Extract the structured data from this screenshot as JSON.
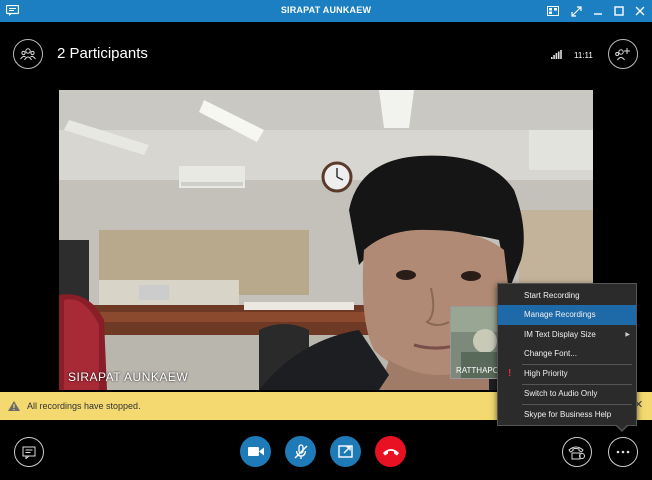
{
  "window": {
    "title": "SIRAPAT AUNKAEW",
    "controls": [
      "window-layout-icon",
      "fullscreen-icon",
      "minimize-icon",
      "maximize-icon",
      "close-icon"
    ]
  },
  "header": {
    "participants_label": "2 Participants",
    "time": "11:11"
  },
  "video": {
    "speaker_name": "SIRAPAT AUNKAEW",
    "self_view_name": "RATTHAPO"
  },
  "notification": {
    "text": "All recordings have stopped.",
    "close_label": "✕"
  },
  "menu": {
    "items": [
      {
        "label": "Start Recording"
      },
      {
        "label": "Manage Recordings"
      },
      {
        "label": "IM Text Display Size"
      },
      {
        "label": "Change Font..."
      },
      {
        "label": "High Priority"
      },
      {
        "label": "Switch to Audio Only"
      },
      {
        "label": "Skype for Business Help"
      }
    ],
    "selected_index": 1
  },
  "controls": {
    "accent": "#1f7ab8",
    "hangup_color": "#e81123",
    "buttons": [
      "im-icon",
      "video-icon",
      "mic-muted-icon",
      "present-icon",
      "hang-up-icon",
      "call-controls-icon",
      "more-options-icon"
    ]
  },
  "colors": {
    "titlebar": "#1b7fc1",
    "notification": "#f3d96f",
    "menu_selected": "#1e6aa8"
  }
}
